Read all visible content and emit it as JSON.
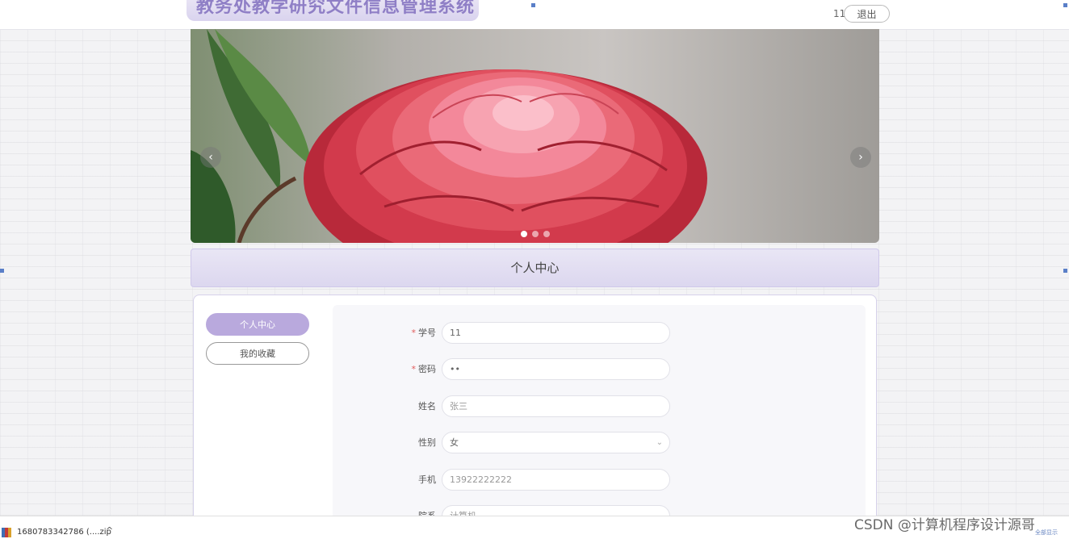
{
  "header": {
    "system_title": "教务处教学研究文件信息管理系统",
    "username": "11",
    "logout_label": "退出"
  },
  "carousel": {
    "prev_icon": "chevron-left-icon",
    "next_icon": "chevron-right-icon",
    "prev_glyph": "‹",
    "next_glyph": "›",
    "slide_count": 3,
    "active_slide": 1
  },
  "section": {
    "title": "个人中心"
  },
  "sidebar": {
    "items": [
      {
        "label": "个人中心",
        "active": true
      },
      {
        "label": "我的收藏",
        "active": false
      }
    ]
  },
  "form": {
    "fields": [
      {
        "label": "学号",
        "required": true,
        "value": "11"
      },
      {
        "label": "密码",
        "required": true,
        "value": "••"
      },
      {
        "label": "姓名",
        "required": false,
        "value": "张三"
      },
      {
        "label": "性别",
        "required": false,
        "value": "女"
      },
      {
        "label": "手机",
        "required": false,
        "value": "13922222222"
      },
      {
        "label": "院系",
        "required": false,
        "value": "计算机"
      }
    ],
    "required_mark": "*",
    "select_chevron": "⌄"
  },
  "download_bar": {
    "file_name": "1680783342786 (....zip",
    "expand_glyph": "^"
  },
  "watermark": "CSDN @计算机程序设计源哥",
  "show_all": "全部显示",
  "colors": {
    "accent": "#b9a9dd",
    "title_text": "#8f7fc6",
    "required": "#e05b5b"
  }
}
